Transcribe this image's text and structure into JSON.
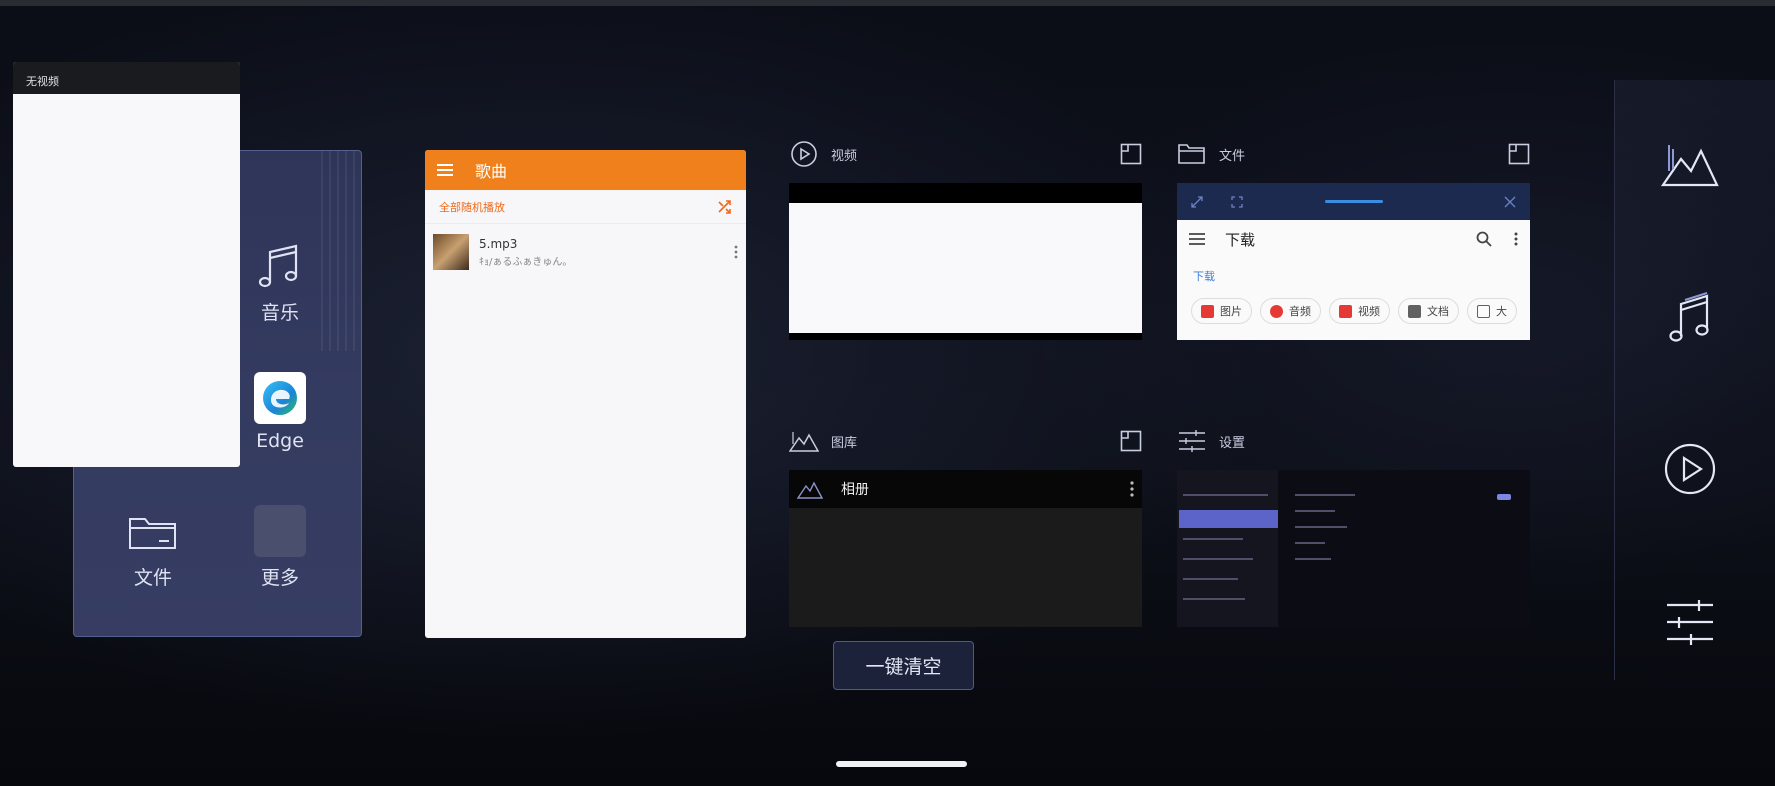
{
  "launcher": {
    "apps": [
      {
        "label": "音乐",
        "icon": "music-note-icon"
      },
      {
        "label": "Edge",
        "icon": "edge-icon"
      },
      {
        "label": "文件",
        "icon": "folder-icon"
      },
      {
        "label": "更多",
        "icon": "more-apps-icon"
      }
    ]
  },
  "floating_window": {
    "title": "无视频"
  },
  "music_card": {
    "header_title": "歌曲",
    "shuffle_label": "全部随机播放",
    "songs": [
      {
        "name": "5.mp3",
        "artist": "ｷｮ/ぁるふぁきゅん。"
      }
    ]
  },
  "tasks": {
    "video": {
      "label": "视频"
    },
    "files": {
      "label": "文件",
      "title": "下载",
      "breadcrumb": "下载",
      "chips": [
        {
          "label": "图片",
          "color": "#e53935"
        },
        {
          "label": "音频",
          "color": "#e53935"
        },
        {
          "label": "视频",
          "color": "#e53935"
        },
        {
          "label": "文档",
          "color": "#616161"
        },
        {
          "label": "大",
          "color": "#616161"
        }
      ]
    },
    "gallery": {
      "label": "图库",
      "album_title": "相册"
    },
    "settings": {
      "label": "设置"
    }
  },
  "clear_button": {
    "label": "一键清空"
  },
  "dock": {
    "items": [
      {
        "name": "gallery",
        "icon": "mountains-icon"
      },
      {
        "name": "music",
        "icon": "music-note-icon"
      },
      {
        "name": "video",
        "icon": "play-circle-icon"
      },
      {
        "name": "settings",
        "icon": "sliders-icon"
      }
    ]
  },
  "colors": {
    "accent_orange": "#f0801b",
    "panel": "#343b60",
    "link_blue": "#3f7fd6"
  }
}
